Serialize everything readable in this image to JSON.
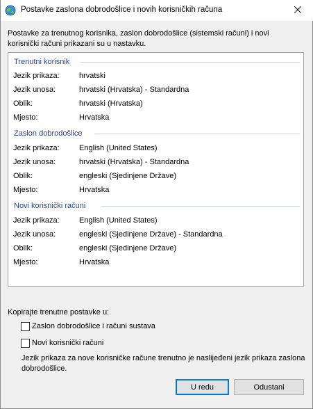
{
  "window": {
    "title": "Postavke zaslona dobrodošlice i novih korisničkih računa"
  },
  "intro": "Postavke za trenutnog korisnika, zaslon dobrodošlice (sistemski računi) i novi korisnički računi prikazani su u nastavku.",
  "sections": [
    {
      "heading": "Trenutni korisnik",
      "rows": [
        {
          "label": "Jezik prikaza:",
          "value": "hrvatski"
        },
        {
          "label": "Jezik unosa:",
          "value": "hrvatski (Hrvatska) - Standardna"
        },
        {
          "label": "Oblik:",
          "value": "hrvatski (Hrvatska)"
        },
        {
          "label": "Mjesto:",
          "value": "Hrvatska"
        }
      ]
    },
    {
      "heading": "Zaslon dobrodošlice",
      "rows": [
        {
          "label": "Jezik prikaza:",
          "value": "English (United States)"
        },
        {
          "label": "Jezik unosa:",
          "value": "hrvatski (Hrvatska) - Standardna"
        },
        {
          "label": "Oblik:",
          "value": "engleski (Sjedinjene Države)"
        },
        {
          "label": "Mjesto:",
          "value": "Hrvatska"
        }
      ]
    },
    {
      "heading": "Novi korisnički računi",
      "rows": [
        {
          "label": "Jezik prikaza:",
          "value": "English (United States)"
        },
        {
          "label": "Jezik unosa:",
          "value": "engleski (Sjedinjene Države) - Standardna"
        },
        {
          "label": "Oblik:",
          "value": "engleski (Sjedinjene Države)"
        },
        {
          "label": "Mjesto:",
          "value": "Hrvatska"
        }
      ]
    }
  ],
  "copy": {
    "label": "Kopirajte trenutne postavke u:",
    "options": [
      {
        "label": "Zaslon dobrodošlice i računi sustava",
        "checked": false
      },
      {
        "label": "Novi korisnički računi",
        "checked": false
      }
    ],
    "note": "Jezik prikaza za nove korisničke račune trenutno je naslijeđeni jezik prikaza zaslona dobrodošlice."
  },
  "buttons": {
    "ok": "U redu",
    "cancel": "Odustani"
  },
  "icons": {
    "window_icon": "globe-icon",
    "close": "close-icon"
  },
  "colors": {
    "section_heading": "#1e44a5",
    "default_button_border": "#0078d7"
  }
}
